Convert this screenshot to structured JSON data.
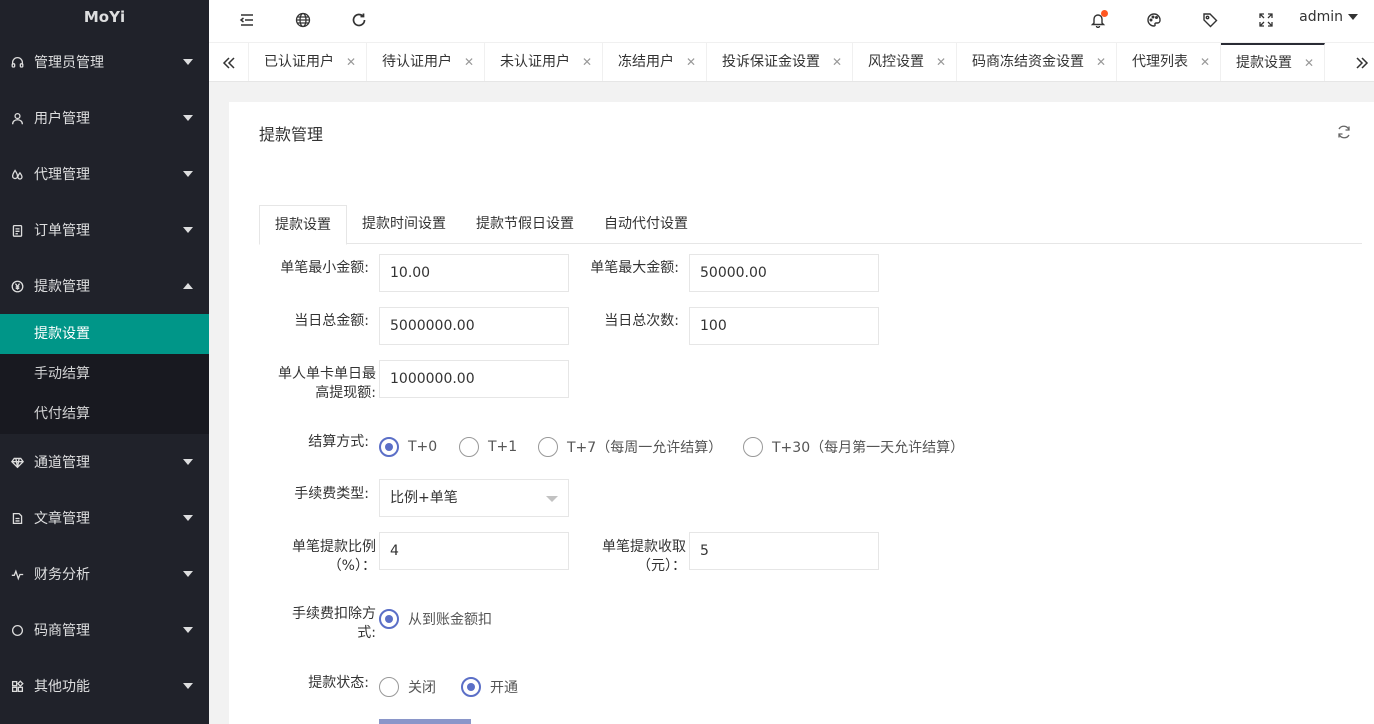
{
  "app": {
    "logo": "MoYi"
  },
  "sidebar": {
    "items": [
      {
        "label": "管理员管理",
        "icon": "headset-icon"
      },
      {
        "label": "用户管理",
        "icon": "user-icon"
      },
      {
        "label": "代理管理",
        "icon": "drops-icon"
      },
      {
        "label": "订单管理",
        "icon": "clipboard-icon"
      },
      {
        "label": "提款管理",
        "icon": "yen-icon"
      },
      {
        "label": "通道管理",
        "icon": "diamond-icon"
      },
      {
        "label": "文章管理",
        "icon": "document-icon"
      },
      {
        "label": "财务分析",
        "icon": "pulse-icon"
      },
      {
        "label": "码商管理",
        "icon": "circle-icon"
      },
      {
        "label": "其他功能",
        "icon": "apps-icon"
      }
    ],
    "submenu": [
      {
        "label": "提款设置"
      },
      {
        "label": "手动结算"
      },
      {
        "label": "代付结算"
      }
    ]
  },
  "header": {
    "user": "admin"
  },
  "tabs": [
    {
      "label": "已认证用户"
    },
    {
      "label": "待认证用户"
    },
    {
      "label": "未认证用户"
    },
    {
      "label": "冻结用户"
    },
    {
      "label": "投诉保证金设置"
    },
    {
      "label": "风控设置"
    },
    {
      "label": "码商冻结资金设置"
    },
    {
      "label": "代理列表"
    },
    {
      "label": "提款设置"
    }
  ],
  "card": {
    "title": "提款管理"
  },
  "subtabs": [
    {
      "label": "提款设置"
    },
    {
      "label": "提款时间设置"
    },
    {
      "label": "提款节假日设置"
    },
    {
      "label": "自动代付设置"
    }
  ],
  "form": {
    "min_amount": {
      "label": "单笔最小金额:",
      "value": "10.00"
    },
    "max_amount": {
      "label": "单笔最大金额:",
      "value": "50000.00"
    },
    "daily_total": {
      "label": "当日总金额:",
      "value": "5000000.00"
    },
    "daily_count": {
      "label": "当日总次数:",
      "value": "100"
    },
    "card_limit": {
      "label_line1": "单人单卡单日最",
      "label_line2": "高提现额:",
      "value": "1000000.00"
    },
    "settle": {
      "label": "结算方式:",
      "options": [
        "T+0",
        "T+1",
        "T+7（每周一允许结算）",
        "T+30（每月第一天允许结算）"
      ],
      "selected": "T+0"
    },
    "fee_type": {
      "label": "手续费类型:",
      "value": "比例+单笔"
    },
    "fee_ratio": {
      "label_line1": "单笔提款比例",
      "label_line2": "（%）：",
      "value": "4"
    },
    "fee_fixed": {
      "label_line1": "单笔提款收取",
      "label_line2": "（元）：",
      "value": "5"
    },
    "deduct": {
      "label_line1": "手续费扣除方",
      "label_line2": "式:",
      "option": "从到账金额扣"
    },
    "status": {
      "label": "提款状态:",
      "options": [
        "关闭",
        "开通"
      ],
      "selected": "开通"
    }
  },
  "colors": {
    "sidebar_bg": "#20222a",
    "active_green": "#009688",
    "radio_blue": "#5b6fc7"
  }
}
